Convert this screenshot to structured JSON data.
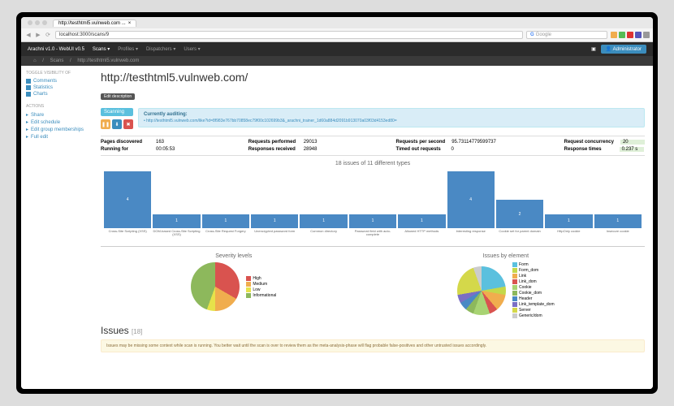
{
  "browser": {
    "tab_title": "http://testhtml5.vulnweb.com ...",
    "url": "localhost:3000/scans/9",
    "search_placeholder": "Google"
  },
  "nav": {
    "brand": "Arachni v1.0 - WebUI v0.5",
    "items": [
      "Scans ▾",
      "Profiles ▾",
      "Dispatchers ▾",
      "Users ▾"
    ],
    "admin": "Administrator"
  },
  "breadcrumb": {
    "home": "⌂",
    "scans": "Scans",
    "target": "http://testhtml5.vulnweb.com"
  },
  "sidebar": {
    "toggle_title": "TOGGLE VISIBILITY OF",
    "toggles": [
      {
        "label": "Comments",
        "on": true
      },
      {
        "label": "Statistics",
        "on": true
      },
      {
        "label": "Charts",
        "on": true
      }
    ],
    "actions_title": "ACTIONS",
    "actions": [
      {
        "label": "Share"
      },
      {
        "label": "Edit schedule"
      },
      {
        "label": "Edit group memberships"
      },
      {
        "label": "Full edit"
      }
    ]
  },
  "page": {
    "title": "http://testhtml5.vulnweb.com/",
    "edit_desc": "Edit description",
    "scanning": "Scanning",
    "auditing_title": "Currently auditing:",
    "auditing_url": "http://testhtml5.vulnweb.com/like?id=8f983e767bb70858ec79f00c102699b3&_arachni_trainer_1d60a884d2091b913070a03f03d4153ed80="
  },
  "stats": {
    "pages_discovered_l": "Pages discovered",
    "pages_discovered_v": "163",
    "running_for_l": "Running for",
    "running_for_v": "00:05:53",
    "requests_performed_l": "Requests performed",
    "requests_performed_v": "29013",
    "responses_received_l": "Responses received",
    "responses_received_v": "28948",
    "rps_l": "Requests per second",
    "rps_v": "95.73114779599737",
    "timed_out_l": "Timed out requests",
    "timed_out_v": "0",
    "concurrency_l": "Request concurrency",
    "concurrency_v": "20",
    "response_times_l": "Response times",
    "response_times_v": "0.237 s"
  },
  "chart_data": [
    {
      "type": "bar",
      "title": "18 issues of 11 different types",
      "categories": [
        "Cross-Site Scripting (XSS)",
        "DOM-based Cross-Site Scripting (XSS)",
        "Cross-Site Request Forgery",
        "Unencrypted password form",
        "Common directory",
        "Password field with auto-complete",
        "Allowed HTTP methods",
        "Interesting response",
        "Cookie set for parent domain",
        "HttpOnly cookie",
        "Insecure cookie"
      ],
      "values": [
        4,
        1,
        1,
        1,
        1,
        1,
        1,
        4,
        2,
        1,
        1
      ],
      "ylim": [
        0,
        4
      ]
    },
    {
      "type": "pie",
      "title": "Severity levels",
      "series": [
        {
          "name": "High",
          "value": 6,
          "color": "#d9534f"
        },
        {
          "name": "Medium",
          "value": 3,
          "color": "#f0ad4e"
        },
        {
          "name": "Low",
          "value": 1,
          "color": "#e6e24a"
        },
        {
          "name": "Informational",
          "value": 8,
          "color": "#8db85c"
        }
      ]
    },
    {
      "type": "pie",
      "title": "Issues by element",
      "series": [
        {
          "name": "Form",
          "value": 4,
          "color": "#5bc0de"
        },
        {
          "name": "Form_dom",
          "value": 1,
          "color": "#c4d84a"
        },
        {
          "name": "Link",
          "value": 2,
          "color": "#f0ad4e"
        },
        {
          "name": "Link_dom",
          "value": 1,
          "color": "#d9534f"
        },
        {
          "name": "Cookie",
          "value": 2,
          "color": "#a8d373"
        },
        {
          "name": "Cookie_dom",
          "value": 1,
          "color": "#8db85c"
        },
        {
          "name": "Header",
          "value": 1,
          "color": "#4a89c4"
        },
        {
          "name": "Link_template_dom",
          "value": 1,
          "color": "#7a6fc4"
        },
        {
          "name": "Server",
          "value": 4,
          "color": "#d4d84a"
        },
        {
          "name": "Generic/dom",
          "value": 1,
          "color": "#ccc"
        }
      ]
    }
  ],
  "issues": {
    "heading": "Issues",
    "count": "[18]",
    "warning": "Issues may be missing some context while scan is running.\nYou better wait until the scan is over to review them as the meta-analysis-phase will flag probable false-positives and other untrusted issues accordingly."
  }
}
